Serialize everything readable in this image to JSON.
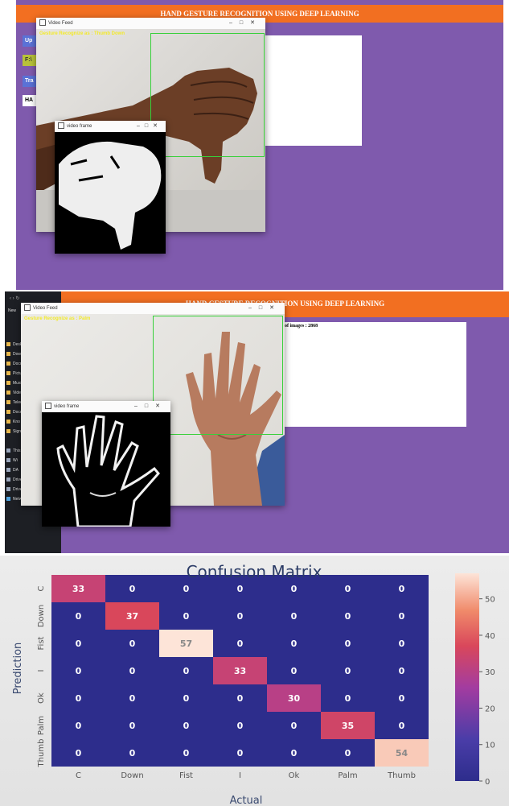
{
  "panel1": {
    "app_title": "HAND GESTURE RECOGNITION USING DEEP LEARNING",
    "side_buttons": [
      "Up",
      "F:\\",
      "Tra"
    ],
    "side_label": "HA",
    "frame_window": {
      "title": "Video Feed",
      "overlay": "Gesture Recognize as : Thumb Down"
    },
    "mask_window": {
      "title": "video frame"
    }
  },
  "panel2": {
    "app_title": "HAND GESTURE RECOGNITION USING DEEP LEARNING",
    "info_text": "of images : 2868",
    "frame_window": {
      "title": "Video Feed",
      "overlay": "Gesture Recognize as : Palm"
    },
    "mask_window": {
      "title": "video frame"
    },
    "explorer": {
      "top_label": "New",
      "items": [
        "Desk",
        "Down",
        "Docu",
        "Pictu",
        "Music",
        "Video",
        "Telec",
        "Docu",
        "Kno",
        "Signi"
      ],
      "drives": [
        "This",
        "Wi",
        "DA",
        "Drive (E:)",
        "Drive (F:)"
      ],
      "network": "Network"
    }
  },
  "chart_data": {
    "type": "heatmap",
    "title": "Confusion Matrix",
    "xlabel": "Actual",
    "ylabel": "Prediction",
    "x_categories": [
      "C",
      "Down",
      "Fist",
      "I",
      "Ok",
      "Palm",
      "Thumb"
    ],
    "y_categories": [
      "C",
      "Down",
      "Fist",
      "I",
      "Ok",
      "Palm",
      "Thumb"
    ],
    "values": [
      [
        33,
        0,
        0,
        0,
        0,
        0,
        0
      ],
      [
        0,
        37,
        0,
        0,
        0,
        0,
        0
      ],
      [
        0,
        0,
        57,
        0,
        0,
        0,
        0
      ],
      [
        0,
        0,
        0,
        33,
        0,
        0,
        0
      ],
      [
        0,
        0,
        0,
        0,
        30,
        0,
        0
      ],
      [
        0,
        0,
        0,
        0,
        0,
        35,
        0
      ],
      [
        0,
        0,
        0,
        0,
        0,
        0,
        54
      ]
    ],
    "colorbar_ticks": [
      0,
      10,
      20,
      30,
      40,
      50
    ],
    "colorbar_range": [
      0,
      57
    ],
    "colormap": [
      "#2d2d8c",
      "#4a3da8",
      "#a33ca0",
      "#d9475b",
      "#f08a6a",
      "#fde4d8"
    ]
  }
}
